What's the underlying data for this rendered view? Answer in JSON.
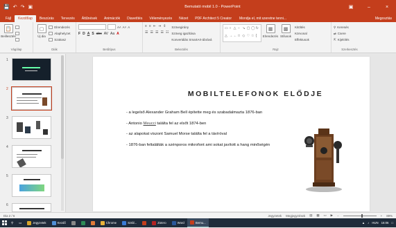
{
  "window": {
    "title": "Bemutató mobil 1.0 - PowerPoint",
    "user_btn": "▣",
    "minimize": "–",
    "close": "×"
  },
  "qat": {
    "save": "💾",
    "undo": "↶",
    "redo": "↷",
    "present": "▣"
  },
  "tabs": [
    "Fájl",
    "Kezdőlap",
    "Beszúrás",
    "Tervezés",
    "Áttűnések",
    "Animációk",
    "Diavetítés",
    "Véleményezés",
    "Nézet",
    "PDF Architect 5 Creator"
  ],
  "active_tab": "Kezdőlap",
  "tell_me": "Mondja el, mit szeretne tenni...",
  "share": "Megosztás",
  "ribbon": {
    "clipboard": {
      "paste": "Beillesztés",
      "label": "Vágólap"
    },
    "slides": {
      "new_slide": "Új dia",
      "layout": "Elrendezés",
      "reset": "Alaphelyzet",
      "section": "Szakasz",
      "label": "Diák"
    },
    "font": {
      "bold": "F",
      "italic": "D",
      "underline": "A",
      "shadow": "S",
      "strike": "abc",
      "spacing": "AV",
      "case": "Aa",
      "color": "A",
      "grow": "A˄",
      "shrink": "A˅",
      "clear": "A",
      "label": "Betűtípus"
    },
    "paragraph": {
      "text_direction": "Szövegirány",
      "align_text": "Szöveg igazítása",
      "smartart": "Konvertálás SmartArt-ábrává",
      "label": "Bekezdés"
    },
    "drawing": {
      "arrange": "Elrendezés",
      "quick_styles": "Stílusok",
      "fill": "Kitöltés",
      "outline": "Körvonal",
      "effects": "Effektusok",
      "label": "Rajz"
    },
    "editing": {
      "find": "Keresés",
      "replace": "Csere",
      "select": "Kijelölés",
      "label": "Szerkesztés"
    }
  },
  "thumbnails": [
    {
      "num": "1",
      "kind": "dark"
    },
    {
      "num": "2",
      "kind": "current"
    },
    {
      "num": "3",
      "kind": "phones"
    },
    {
      "num": "4",
      "kind": "list"
    },
    {
      "num": "5",
      "kind": "chart"
    },
    {
      "num": "6",
      "kind": "text"
    }
  ],
  "slide": {
    "title": "MOBILTELEFONOK ELŐDJE",
    "bullets": [
      {
        "pre": "- a legelső Alexander Graham Bell építette meg és szabadalmazta 1876-ban",
        "u": "",
        "post": ""
      },
      {
        "pre": "- Antonio ",
        "u": "Meucci",
        "post": " találta fel az elsőt 1874-ben"
      },
      {
        "pre": "- az alapokat viszont Samuel Morse találta fel a távíróval",
        "u": "",
        "post": ""
      },
      {
        "pre": "- 1876-ban feltalálták a szénporos mikrofont ami sokat javított a hang minőségén",
        "u": "",
        "post": ""
      }
    ]
  },
  "status": {
    "slide_info": "Dia 2 / 6",
    "notes": "Jegyzetek",
    "comments": "Megjegyzések",
    "zoom": "89%"
  },
  "taskbar": {
    "items": [
      {
        "label": "Jegyzetek",
        "color": "#d6a52b"
      },
      {
        "label": "Kezdő",
        "color": "#4f8fd6"
      },
      {
        "label": "",
        "color": "#888888"
      },
      {
        "label": "",
        "color": "#2e8b57"
      },
      {
        "label": "",
        "color": "#e07b39"
      },
      {
        "label": "Chrome",
        "color": "#e8b33a"
      },
      {
        "label": "Sztál...",
        "color": "#3a7bd5"
      },
      {
        "label": "",
        "color": "#c43e1c"
      },
      {
        "label": "Zotero",
        "color": "#b22222"
      },
      {
        "label": "Word",
        "color": "#2b579a"
      },
      {
        "label": "Bemu...",
        "color": "#c43e1c"
      }
    ],
    "time": "16:06",
    "date": "2018.01.",
    "lang": "HUN"
  }
}
